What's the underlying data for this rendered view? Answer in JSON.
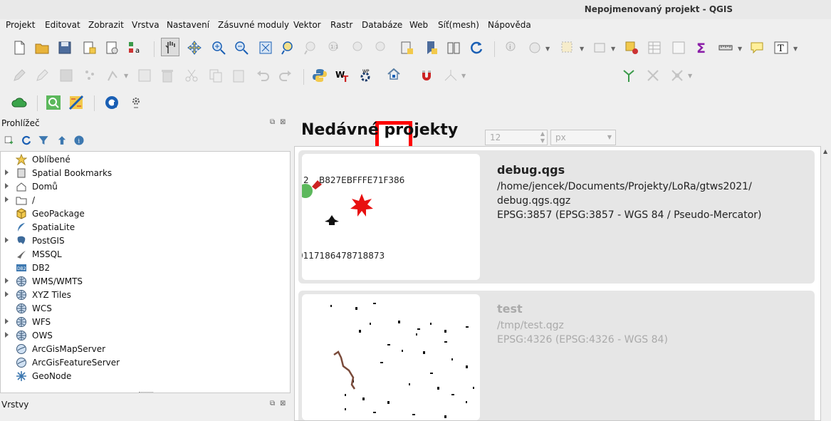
{
  "window": {
    "title": "Nepojmenovaný projekt - QGIS"
  },
  "menu": [
    "Projekt",
    "Editovat",
    "Zobrazit",
    "Vrstva",
    "Nastavení",
    "Zásuvné moduly",
    "Vektor",
    "Rastr",
    "Databáze",
    "Web",
    "Síť(mesh)",
    "Nápověda"
  ],
  "toolbar": {
    "font_size_value": "12",
    "font_unit": "px"
  },
  "browser": {
    "title": "Prohlížeč",
    "items": [
      {
        "label": "Oblíbené",
        "icon": "star-icon",
        "expandable": false
      },
      {
        "label": "Spatial Bookmarks",
        "icon": "bookmark-icon",
        "expandable": true
      },
      {
        "label": "Domů",
        "icon": "home-folder-icon",
        "expandable": true
      },
      {
        "label": "/",
        "icon": "folder-icon",
        "expandable": true
      },
      {
        "label": "GeoPackage",
        "icon": "geopackage-icon",
        "expandable": false
      },
      {
        "label": "SpatiaLite",
        "icon": "spatialite-icon",
        "expandable": false
      },
      {
        "label": "PostGIS",
        "icon": "postgis-icon",
        "expandable": true
      },
      {
        "label": "MSSQL",
        "icon": "mssql-icon",
        "expandable": false
      },
      {
        "label": "DB2",
        "icon": "db2-icon",
        "expandable": false
      },
      {
        "label": "WMS/WMTS",
        "icon": "globe-icon",
        "expandable": true
      },
      {
        "label": "XYZ Tiles",
        "icon": "globe-icon",
        "expandable": true
      },
      {
        "label": "WCS",
        "icon": "globe-icon",
        "expandable": false
      },
      {
        "label": "WFS",
        "icon": "globe-icon",
        "expandable": true
      },
      {
        "label": "OWS",
        "icon": "globe-icon",
        "expandable": true
      },
      {
        "label": "ArcGisMapServer",
        "icon": "arcgis-icon",
        "expandable": false
      },
      {
        "label": "ArcGisFeatureServer",
        "icon": "arcgis-icon",
        "expandable": false
      },
      {
        "label": "GeoNode",
        "icon": "geonode-icon",
        "expandable": false
      }
    ]
  },
  "layers": {
    "title": "Vrstvy"
  },
  "welcome": {
    "title": "Nedávné projekty",
    "projects": [
      {
        "name": "debug.qgs",
        "path_line1": "/home/jencek/Documents/Projekty/LoRa/gtws2021/",
        "path_line2": "debug.qgs.qgz",
        "crs": "EPSG:3857 (EPSG:3857 - WGS 84 / Pseudo-Mercator)",
        "thumb_label_top": "B827EBFFFE71F386",
        "thumb_label_top_prefix": "2",
        "thumb_label_bottom": "0117186478718873",
        "available": true
      },
      {
        "name": "test",
        "path_line1": "/tmp/test.qgz",
        "crs": "EPSG:4326 (EPSG:4326 - WGS 84)",
        "available": false
      }
    ]
  },
  "colors": {
    "highlight": "#ff0000",
    "unavailable_text": "#aaaaaa"
  }
}
